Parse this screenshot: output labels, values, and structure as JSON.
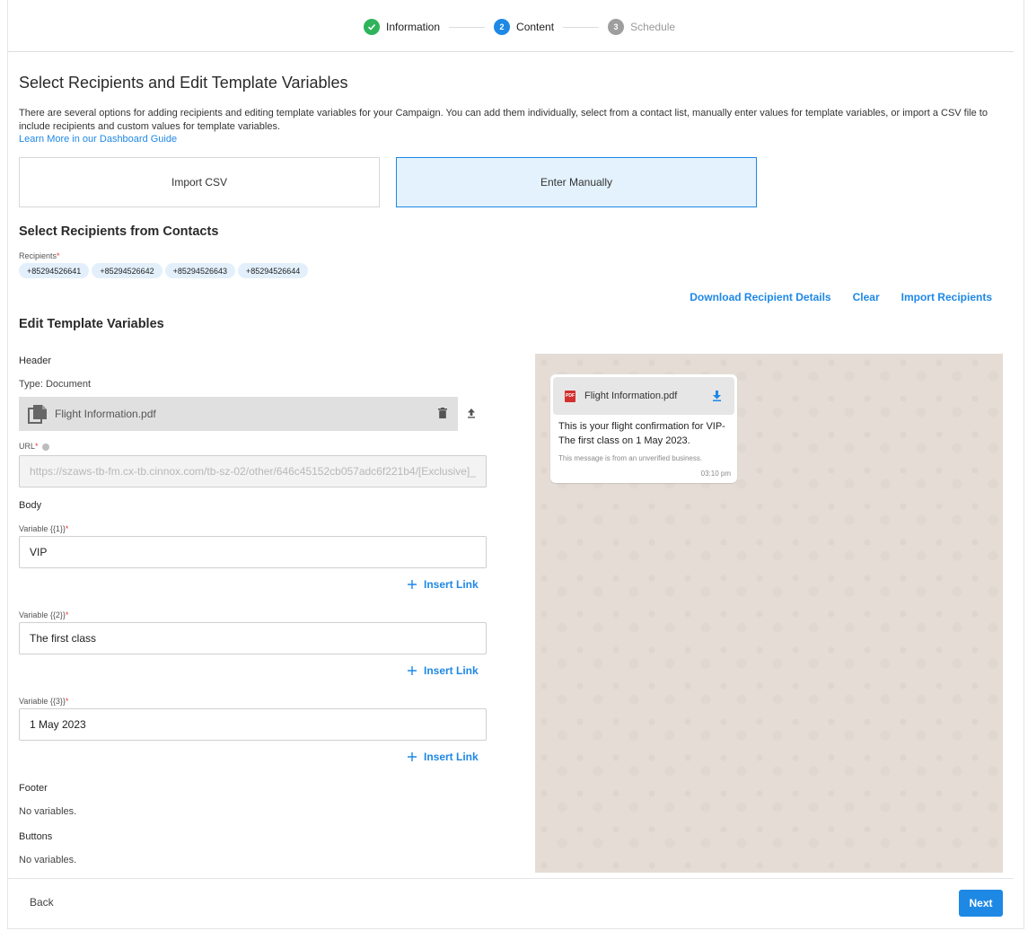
{
  "stepper": {
    "steps": [
      {
        "number": "",
        "label": "Information",
        "state": "done"
      },
      {
        "number": "2",
        "label": "Content",
        "state": "active"
      },
      {
        "number": "3",
        "label": "Schedule",
        "state": "pending"
      }
    ]
  },
  "page": {
    "title": "Select Recipients and Edit Template Variables",
    "description": "There are several options for adding recipients and editing template variables for your Campaign. You can add them individually, select from a contact list, manually enter values for template variables, or import a CSV file to include recipients and custom values for template variables.",
    "learn_more": "Learn More in our Dashboard Guide"
  },
  "options": {
    "import_csv": "Import CSV",
    "enter_manually": "Enter Manually",
    "selected": "enter_manually"
  },
  "recipients": {
    "section_title": "Select Recipients from Contacts",
    "label": "Recipients",
    "chips": [
      "+85294526641",
      "+85294526642",
      "+85294526643",
      "+85294526644"
    ],
    "actions": {
      "download": "Download Recipient Details",
      "clear": "Clear",
      "import": "Import Recipients"
    }
  },
  "template": {
    "section_title": "Edit Template Variables",
    "header": {
      "label": "Header",
      "type": "Type: Document",
      "file_name": "Flight Information.pdf",
      "url_label": "URL",
      "url_value": "https://szaws-tb-fm.cx-tb.cinnox.com/tb-sz-02/other/646c45152cb057adc6f221b4/[Exclusive]_"
    },
    "body": {
      "label": "Body",
      "insert_link": "Insert Link",
      "variables": [
        {
          "label": "Variable {{1}}",
          "value": "VIP"
        },
        {
          "label": "Variable {{2}}",
          "value": "The first class"
        },
        {
          "label": "Variable {{3}}",
          "value": "1 May 2023"
        }
      ]
    },
    "footer": {
      "label": "Footer",
      "text": "No variables."
    },
    "buttons": {
      "label": "Buttons",
      "text": "No variables."
    }
  },
  "preview": {
    "file_name": "Flight Information.pdf",
    "pdf_badge": "PDF",
    "message": "This is your flight confirmation for VIP- The first class on 1 May 2023.",
    "note": "This message is from an unverified business.",
    "time": "03:10 pm"
  },
  "footer_nav": {
    "back": "Back",
    "next": "Next"
  },
  "colors": {
    "accent": "#1e88e5",
    "success": "#2fb35b",
    "selected_bg": "#e3f2fd",
    "chat_bg": "#e5ddd5"
  }
}
